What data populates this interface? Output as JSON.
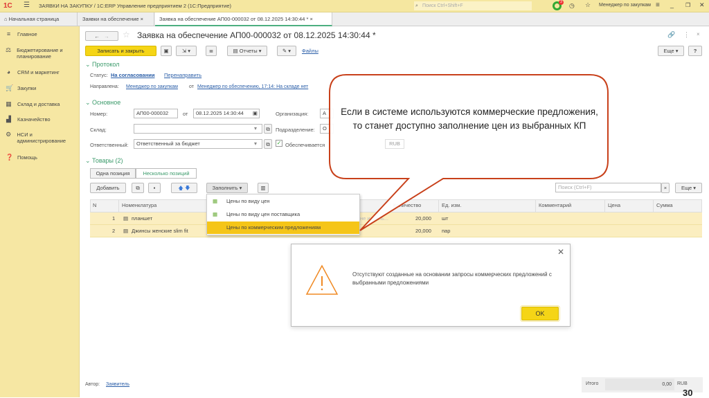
{
  "app": {
    "logo": "1С",
    "title": "ЗАЯВКИ НА ЗАКУПКУ / 1С:ERP Управление предприятием 2 (1С:Предприятие)",
    "search_placeholder": "Поиск Ctrl+Shift+F",
    "user": "Менеджер по закупкам",
    "notif_count": "3"
  },
  "tabs": [
    {
      "label": "Начальная страница"
    },
    {
      "label": "Заявки на обеспечение"
    },
    {
      "label": "Заявка на обеспечение АП00-000032 от 08.12.2025 14:30:44 *"
    }
  ],
  "sidebar": {
    "items": [
      {
        "label": "Главное",
        "icon": "menu-icon"
      },
      {
        "label": "Бюджетирование и планирование",
        "icon": "budget-icon"
      },
      {
        "label": "CRM и маркетинг",
        "icon": "crm-icon"
      },
      {
        "label": "Закупки",
        "icon": "cart-icon"
      },
      {
        "label": "Склад и доставка",
        "icon": "warehouse-icon"
      },
      {
        "label": "Казначейство",
        "icon": "treasury-icon"
      },
      {
        "label": "НСИ и администрирование",
        "icon": "gear-icon"
      },
      {
        "label": "Помощь",
        "icon": "help-icon"
      }
    ]
  },
  "doc": {
    "title": "Заявка на обеспечение АП00-000032 от 08.12.2025 14:30:44 *",
    "toolbar": {
      "save_close": "Записать и закрыть",
      "reports": "Отчеты",
      "files": "Файлы",
      "more": "Еще",
      "help": "?"
    },
    "protocol": {
      "header": "Протокол",
      "status_label": "Статус:",
      "status_value": "На согласовании",
      "redirect": "Перенаправить",
      "sent_label": "Направлена:",
      "sent_from": "Менеджер по закупкам",
      "sent_from_word": "от",
      "sent_to": "Менеджер по обеспечению, 17:14: На складе нет"
    },
    "main": {
      "header": "Основное",
      "number_label": "Номер:",
      "number": "АП00-000032",
      "date_label": "от",
      "date": "08.12.2025 14:30:44",
      "org_label": "Организация:",
      "org": "А",
      "warehouse_label": "Склад:",
      "warehouse": "",
      "dept_label": "Подразделение:",
      "dept": "О",
      "resp_label": "Ответственный:",
      "resp": "Ответственный за бюджет",
      "provided_label": "Обеспечивается",
      "currency": "RUB"
    },
    "goods": {
      "header": "Товары (2)",
      "mode_one": "Одна позиция",
      "mode_many": "Несколько позиций",
      "add": "Добавить",
      "fill": "Заполнить",
      "search_placeholder": "Поиск (Ctrl+F)",
      "more": "Еще",
      "columns": [
        "N",
        "Номенклатура",
        "Количество",
        "Ед. изм.",
        "Комментарий",
        "Цена",
        "Сумма"
      ],
      "rows": [
        {
          "n": "1",
          "name": "планшет",
          "note": "не исполь...",
          "qty": "20,000",
          "unit": "шт"
        },
        {
          "n": "2",
          "name": "Джинсы женские slim fit",
          "note": "",
          "qty": "20,000",
          "unit": "пар"
        }
      ]
    },
    "fill_menu": [
      "Цены по виду цен",
      "Цены по виду цен поставщика",
      "Цены по коммерческим предложениям"
    ],
    "footer": {
      "author_label": "Автор:",
      "author": "Заявитель",
      "total_label": "Итого",
      "total": "0,00",
      "currency": "RUB"
    }
  },
  "dialog": {
    "message": "Отсутствуют созданные на основании запросы коммерческих предложений с выбранными предложениями",
    "ok": "OK"
  },
  "callout": {
    "text": "Если в системе используются коммерческие предложения, то станет доступно заполнение цен из выбранных КП"
  },
  "slide_number": "30"
}
